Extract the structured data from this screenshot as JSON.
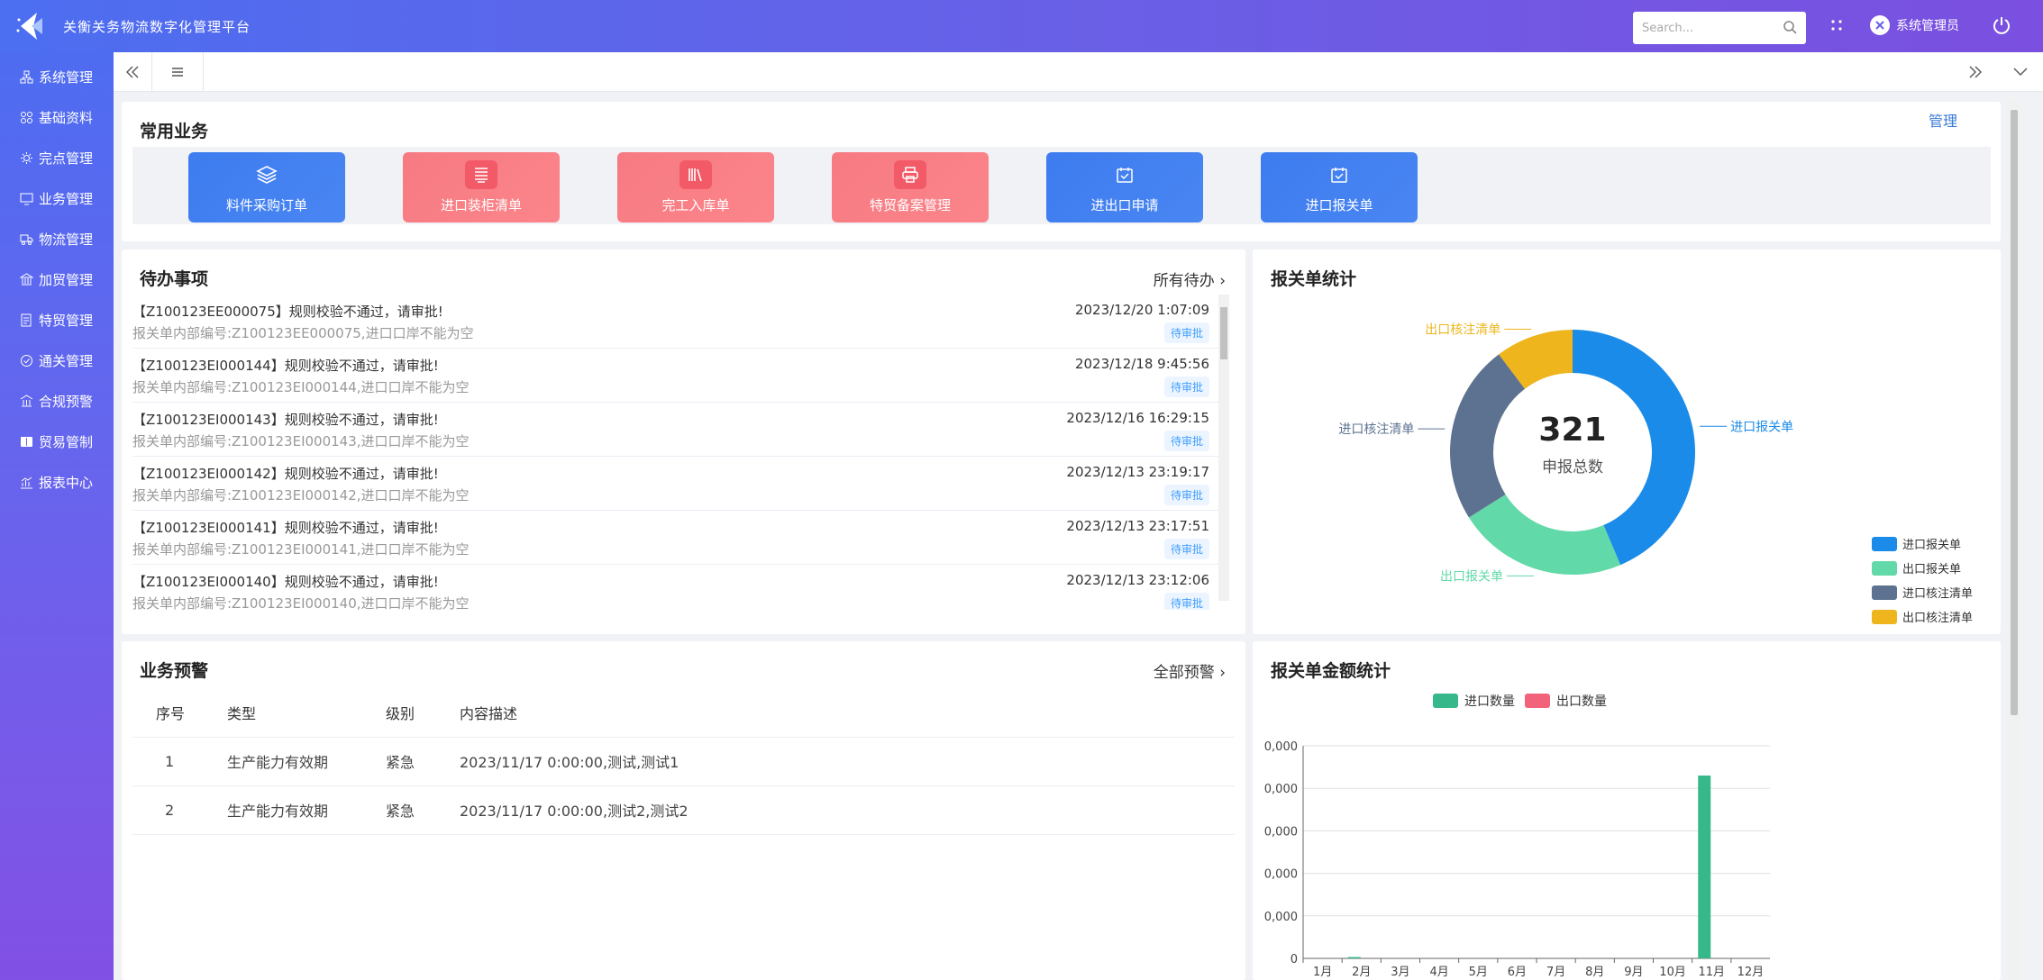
{
  "app": {
    "title": "关衡关务物流数字化管理平台"
  },
  "header": {
    "search_placeholder": "Search...",
    "user": "系统管理员"
  },
  "sidebar": {
    "items": [
      {
        "label": "系统管理",
        "icon": "sitemap-icon"
      },
      {
        "label": "基础资料",
        "icon": "grid-icon"
      },
      {
        "label": "完点管理",
        "icon": "gear-icon"
      },
      {
        "label": "业务管理",
        "icon": "monitor-icon"
      },
      {
        "label": "物流管理",
        "icon": "truck-icon"
      },
      {
        "label": "加贸管理",
        "icon": "bank-icon"
      },
      {
        "label": "特贸管理",
        "icon": "document-icon"
      },
      {
        "label": "通关管理",
        "icon": "check-circle-icon"
      },
      {
        "label": "合规预警",
        "icon": "building-icon"
      },
      {
        "label": "贸易管制",
        "icon": "book-icon"
      },
      {
        "label": "报表中心",
        "icon": "chart-icon"
      }
    ]
  },
  "quick": {
    "title": "常用业务",
    "manage_label": "管理",
    "buttons": [
      {
        "label": "料件采购订单",
        "color": "blue",
        "icon": "layers-icon"
      },
      {
        "label": "进口装柜清单",
        "color": "red",
        "icon": "list-icon"
      },
      {
        "label": "完工入库单",
        "color": "red",
        "icon": "books-icon"
      },
      {
        "label": "特贸备案管理",
        "color": "red",
        "icon": "printer-icon"
      },
      {
        "label": "进出口申请",
        "color": "blue",
        "icon": "calendar-check-icon"
      },
      {
        "label": "进口报关单",
        "color": "blue",
        "icon": "calendar-check-icon"
      }
    ]
  },
  "todo": {
    "title": "待办事项",
    "link": "所有待办",
    "items": [
      {
        "title": "【Z100123EE000075】规则校验不通过，请审批!",
        "sub": "报关单内部编号:Z100123EE000075,进口口岸不能为空",
        "time": "2023/12/20 1:07:09",
        "status": "待审批"
      },
      {
        "title": "【Z100123EI000144】规则校验不通过，请审批!",
        "sub": "报关单内部编号:Z100123EI000144,进口口岸不能为空",
        "time": "2023/12/18 9:45:56",
        "status": "待审批"
      },
      {
        "title": "【Z100123EI000143】规则校验不通过，请审批!",
        "sub": "报关单内部编号:Z100123EI000143,进口口岸不能为空",
        "time": "2023/12/16 16:29:15",
        "status": "待审批"
      },
      {
        "title": "【Z100123EI000142】规则校验不通过，请审批!",
        "sub": "报关单内部编号:Z100123EI000142,进口口岸不能为空",
        "time": "2023/12/13 23:19:17",
        "status": "待审批"
      },
      {
        "title": "【Z100123EI000141】规则校验不通过，请审批!",
        "sub": "报关单内部编号:Z100123EI000141,进口口岸不能为空",
        "time": "2023/12/13 23:17:51",
        "status": "待审批"
      },
      {
        "title": "【Z100123EI000140】规则校验不通过，请审批!",
        "sub": "报关单内部编号:Z100123EI000140,进口口岸不能为空",
        "time": "2023/12/13 23:12:06",
        "status": "待审批"
      }
    ]
  },
  "warn": {
    "title": "业务预警",
    "link": "全部预警",
    "headers": [
      "序号",
      "类型",
      "级别",
      "内容描述"
    ],
    "rows": [
      [
        "1",
        "生产能力有效期",
        "紧急",
        "2023/11/17 0:00:00,测试,测试1"
      ],
      [
        "2",
        "生产能力有效期",
        "紧急",
        "2023/11/17 0:00:00,测试2,测试2"
      ]
    ]
  },
  "stats": {
    "title": "报关单统计",
    "total": "321",
    "total_label": "申报总数",
    "colors": [
      "#1a8be8",
      "#62d9a8",
      "#5d7290",
      "#eeb51d"
    ]
  },
  "amount": {
    "title": "报关单金额统计"
  },
  "chart_data": [
    {
      "type": "pie",
      "title": "报关单统计",
      "categories": [
        "进口报关单",
        "出口报关单",
        "进口核注清单",
        "出口核注清单"
      ],
      "values": [
        140,
        72,
        76,
        33
      ],
      "legend_position": "bottom-right"
    },
    {
      "type": "bar",
      "title": "报关单金额统计",
      "categories": [
        "1月",
        "2月",
        "3月",
        "4月",
        "5月",
        "6月",
        "7月",
        "8月",
        "9月",
        "10月",
        "11月",
        "12月"
      ],
      "series": [
        {
          "name": "进口数量",
          "values": [
            0,
            0.3,
            0,
            0,
            0,
            0,
            0,
            0,
            0,
            0,
            43,
            0
          ],
          "color": "#36b88b"
        },
        {
          "name": "出口数量",
          "values": [
            0,
            0,
            0,
            0,
            0,
            0,
            0,
            0,
            0,
            0,
            0,
            0
          ],
          "color": "#f2637b"
        }
      ],
      "y_tick_labels": [
        "0",
        "0,000",
        "0,000",
        "0,000",
        "0,000",
        "0,000"
      ],
      "ylim": [
        0,
        50
      ],
      "grid": true,
      "legend_position": "top"
    }
  ]
}
